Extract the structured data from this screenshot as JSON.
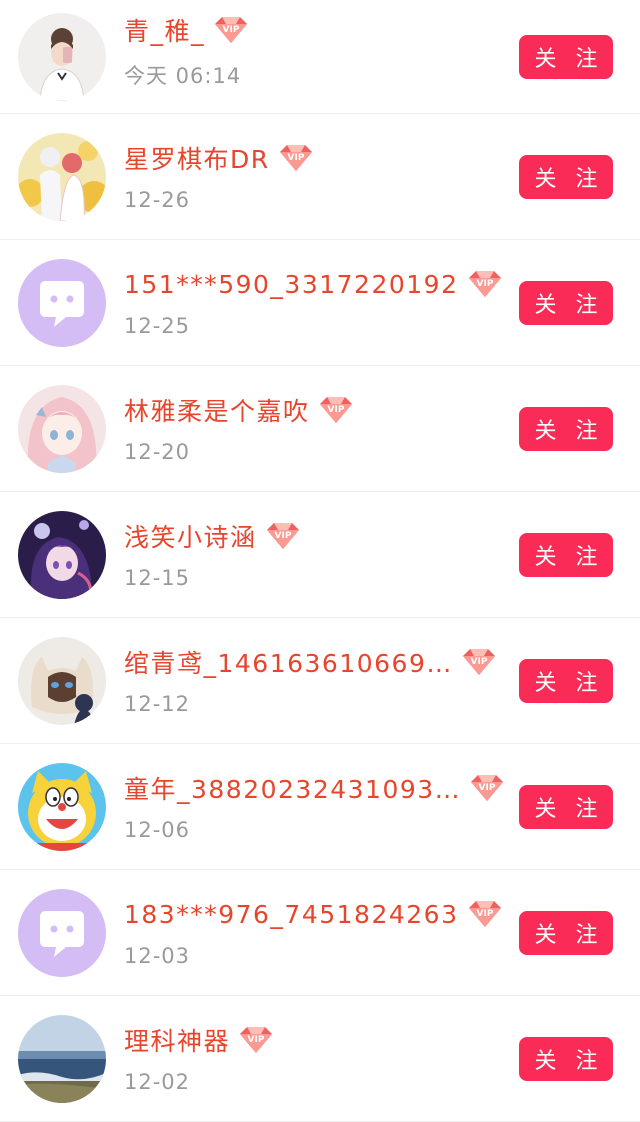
{
  "follow_label": "关 注",
  "users": [
    {
      "name": "青_稚_",
      "time": "今天  06:14",
      "vip_label": "VIP",
      "avatar": "photo-girl"
    },
    {
      "name": "星罗棋布DR",
      "time": "12-26",
      "vip_label": "VIP",
      "avatar": "photo-couple"
    },
    {
      "name": "151***590_3317220192",
      "time": "12-25",
      "vip_label": "VIP",
      "avatar": "default-chat"
    },
    {
      "name": "林雅柔是个嘉吹",
      "time": "12-20",
      "vip_label": "VIP",
      "avatar": "anime-pink"
    },
    {
      "name": "浅笑小诗涵",
      "time": "12-15",
      "vip_label": "VIP",
      "avatar": "anime-dark"
    },
    {
      "name": "绾青鸢_146163610669…",
      "time": "12-12",
      "vip_label": "VIP",
      "avatar": "cat"
    },
    {
      "name": "童年_38820232431093…",
      "time": "12-06",
      "vip_label": "VIP",
      "avatar": "doraemon-yellow"
    },
    {
      "name": "183***976_7451824263",
      "time": "12-03",
      "vip_label": "VIP",
      "avatar": "default-chat"
    },
    {
      "name": "理科神器",
      "time": "12-02",
      "vip_label": "VIP",
      "avatar": "photo-sea"
    }
  ],
  "colors": {
    "name": "#e8452d",
    "time": "#9a9a9a",
    "follow_button": "#fa2b56",
    "vip_badge": "#f0605f",
    "default_avatar": "#d4bcf4"
  }
}
